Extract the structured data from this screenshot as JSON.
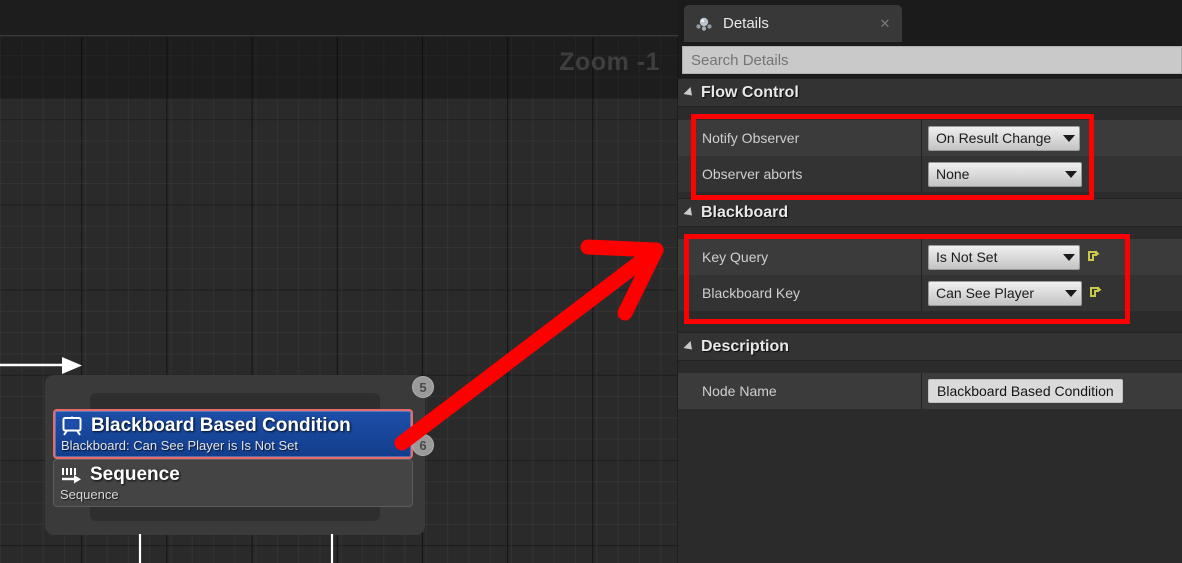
{
  "graph": {
    "zoom_label": "Zoom -1",
    "nodes": [
      {
        "icon": "blackboard-icon",
        "title": "Blackboard Based Condition",
        "subtitle": "Blackboard: Can See Player is Is Not Set",
        "badge": "5",
        "selected": true
      },
      {
        "icon": "sequence-icon",
        "title": "Sequence",
        "subtitle": "Sequence",
        "badge": "6",
        "selected": false
      }
    ]
  },
  "details": {
    "tab_label": "Details",
    "tab_icon": "details-icon",
    "close_icon": "close-icon",
    "search_placeholder": "Search Details",
    "search_value": "",
    "categories": [
      {
        "title": "Flow Control",
        "rows": [
          {
            "label": "Notify Observer",
            "value": "On Result Change",
            "control": "dropdown",
            "revert": false
          },
          {
            "label": "Observer aborts",
            "value": "None",
            "control": "dropdown",
            "revert": false
          }
        ]
      },
      {
        "title": "Blackboard",
        "rows": [
          {
            "label": "Key Query",
            "value": "Is Not Set",
            "control": "dropdown",
            "revert": true
          },
          {
            "label": "Blackboard Key",
            "value": "Can See Player",
            "control": "dropdown",
            "revert": true
          }
        ]
      },
      {
        "title": "Description",
        "rows": [
          {
            "label": "Node Name",
            "value": "Blackboard Based Condition",
            "control": "text",
            "revert": false
          }
        ]
      }
    ]
  },
  "annotations": {
    "highlight_color": "#ff0000",
    "arrow": "red-pointer-arrow",
    "boxes": [
      "flow-control-rows",
      "blackboard-rows",
      "selected-node"
    ]
  }
}
